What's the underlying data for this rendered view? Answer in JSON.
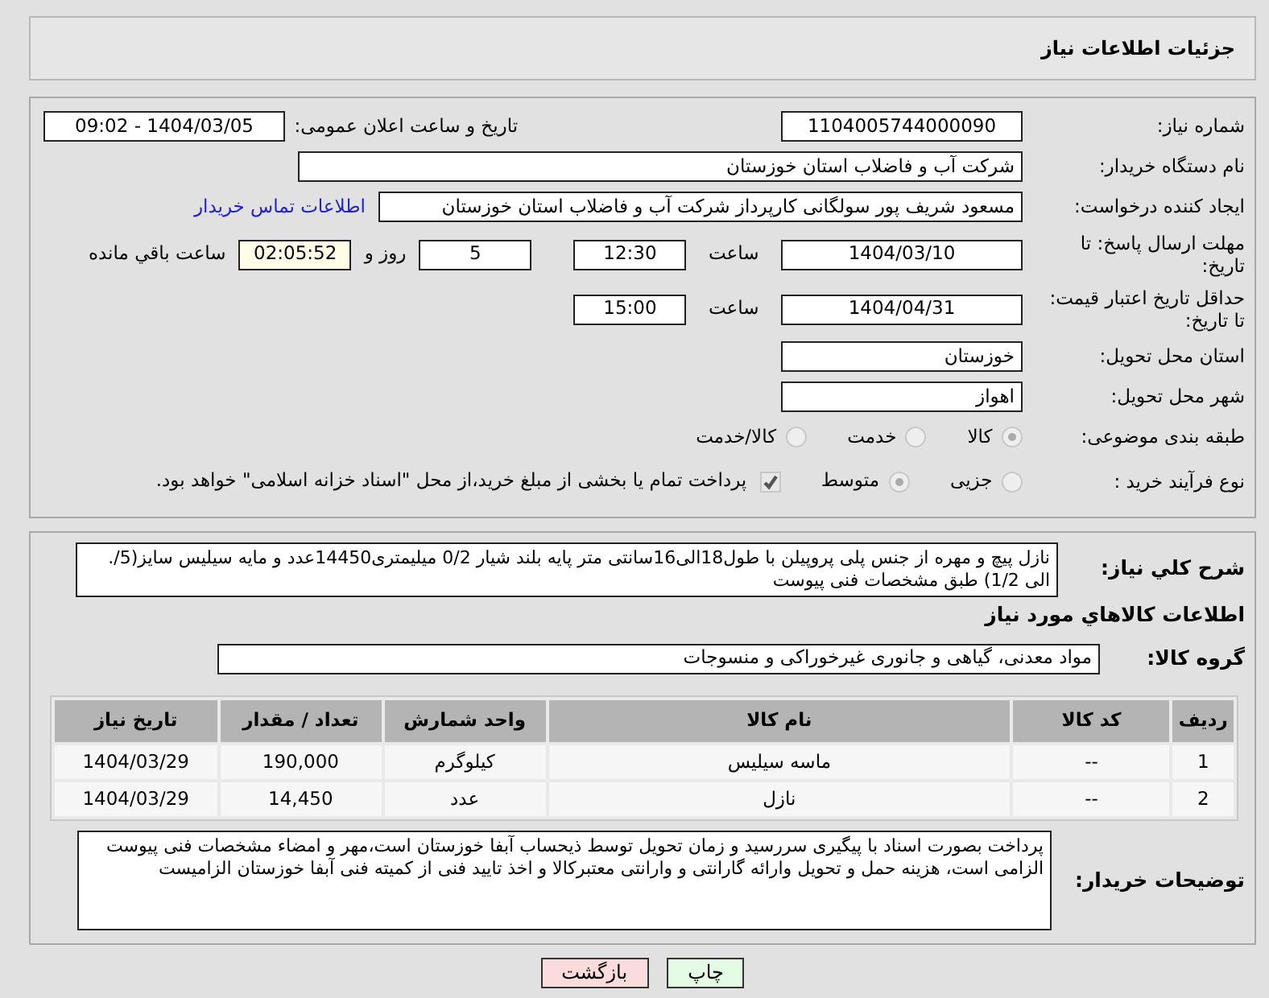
{
  "title": "جزئیات اطلاعات نیاز",
  "need_number": {
    "label": "شماره نیاز:",
    "value": "1104005744000090"
  },
  "announce": {
    "label": "تاریخ و ساعت اعلان عمومی:",
    "value": "1404/03/05 - 09:02"
  },
  "buyer_org": {
    "label": "نام دستگاه خریدار:",
    "value": "شرکت آب و فاضلاب استان خوزستان"
  },
  "requester": {
    "label": "ایجاد کننده درخواست:",
    "value": "مسعود شریف پور سولگانی کارپرداز شرکت آب و فاضلاب استان خوزستان",
    "link": "اطلاعات تماس خریدار"
  },
  "deadline": {
    "label": "مهلت ارسال پاسخ: تا تاریخ:",
    "date": "1404/03/10",
    "time_label": "ساعت",
    "time": "12:30",
    "days": "5",
    "days_label": "روز و",
    "remaining": "02:05:52",
    "remaining_label": "ساعت باقي مانده"
  },
  "validity": {
    "label": "حداقل تاریخ اعتبار قیمت: تا تاریخ:",
    "date": "1404/04/31",
    "time_label": "ساعت",
    "time": "15:00"
  },
  "province": {
    "label": "استان محل تحویل:",
    "value": "خوزستان"
  },
  "city": {
    "label": "شهر محل تحویل:",
    "value": "اهواز"
  },
  "category": {
    "label": "طبقه بندی موضوعی:",
    "options": [
      {
        "label": "کالا",
        "selected": true
      },
      {
        "label": "خدمت",
        "selected": false
      },
      {
        "label": "کالا/خدمت",
        "selected": false
      }
    ]
  },
  "purchase_type": {
    "label": "نوع فرآیند خرید :",
    "options": [
      {
        "label": "جزیی",
        "selected": false
      },
      {
        "label": "متوسط",
        "selected": true
      }
    ],
    "payment": {
      "checked": true,
      "text": "پرداخت تمام یا بخشی از مبلغ خرید،از محل \"اسناد خزانه اسلامی\" خواهد بود."
    }
  },
  "description": {
    "label": "شرح کلي نياز:",
    "value": "نازل پیچ و مهره از جنس  پلی پروپیلن با طول18الی16سانتی متر پایه بلند شیار 0/2 میلیمتری14450عدد و مایه سیلیس سایز(5/. الی 1/2) طبق مشخصات فنی پیوست"
  },
  "goods_heading": "اطلاعات کالاهاي مورد نياز",
  "goods_group": {
    "label": "گروه کالا:",
    "value": "مواد معدنی، گیاهی و جانوری غیرخوراکی و منسوجات"
  },
  "table": {
    "columns": [
      "ردیف",
      "کد کالا",
      "نام کالا",
      "واحد شمارش",
      "تعداد / مقدار",
      "تاریخ نیاز"
    ],
    "rows": [
      [
        "1",
        "--",
        "ماسه سیلیس",
        "کیلوگرم",
        "190,000",
        "1404/03/29"
      ],
      [
        "2",
        "--",
        "نازل",
        "عدد",
        "14,450",
        "1404/03/29"
      ]
    ]
  },
  "buyer_notes": {
    "label": "توضیحات خریدار:",
    "value": "پرداخت بصورت اسناد با پیگیری  سررسید و زمان تحویل توسط ذیحساب آبفا خوزستان است،مهر و امضاء مشخصات فنی پیوست الزامی است، هزینه حمل و تحویل وارائه گارانتی و وارانتی معتبرکالا و اخذ تایید فنی از کمیته فنی آبفا خوزستان الزامیست"
  },
  "buttons": [
    {
      "kind": "print",
      "label": "چاپ"
    },
    {
      "kind": "back",
      "label": "بازگشت"
    }
  ]
}
